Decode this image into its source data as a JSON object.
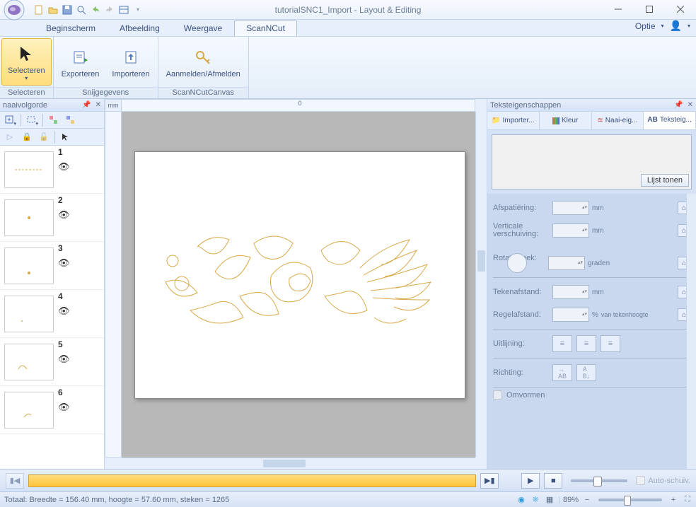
{
  "app": {
    "title": "tutorialSNC1_Import - Layout & Editing"
  },
  "menubar": {
    "tabs": [
      {
        "label": "Beginscherm"
      },
      {
        "label": "Afbeelding"
      },
      {
        "label": "Weergave"
      },
      {
        "label": "ScanNCut"
      }
    ],
    "active_index": 3,
    "optie": "Optie"
  },
  "ribbon": {
    "group1": {
      "label": "Selecteren",
      "select_btn": "Selecteren"
    },
    "group2": {
      "label": "Snijgegevens",
      "export_btn": "Exporteren",
      "import_btn": "Importeren"
    },
    "group3": {
      "label": "ScanNCutCanvas",
      "login_btn": "Aanmelden/Afmelden"
    }
  },
  "left_panel": {
    "title": "naaivolgorde",
    "layers": [
      "1",
      "2",
      "3",
      "4",
      "5",
      "6"
    ]
  },
  "ruler_unit": "mm",
  "ruler_zero": "0",
  "right_panel": {
    "title": "Teksteigenschappen",
    "tabs": [
      {
        "label": "Importer..."
      },
      {
        "label": "Kleur"
      },
      {
        "label": "Naai-eig..."
      },
      {
        "label": "Teksteig..."
      }
    ],
    "active_tab": 3,
    "list_button": "Lijst tonen",
    "props": {
      "afsp": {
        "label": "Afspatiëring:",
        "unit": "mm"
      },
      "vert": {
        "label": "Verticale verschuiving:",
        "unit": "mm"
      },
      "rot": {
        "label": "Rotatiehoek:",
        "unit": "graden"
      },
      "tek": {
        "label": "Tekenafstand:",
        "unit": "mm"
      },
      "reg": {
        "label": "Regelafstand:",
        "unit": "van tekenhoogte",
        "pct": "%"
      },
      "uitl": {
        "label": "Uitlijning:"
      },
      "rich": {
        "label": "Richting:"
      },
      "omv": {
        "label": "Omvormen"
      }
    }
  },
  "playback": {
    "auto_label": "Auto-schuiv."
  },
  "status": {
    "text": "Totaal: Breedte = 156.40 mm, hoogte = 57.60 mm, steken = 1265",
    "zoom": "89%"
  }
}
